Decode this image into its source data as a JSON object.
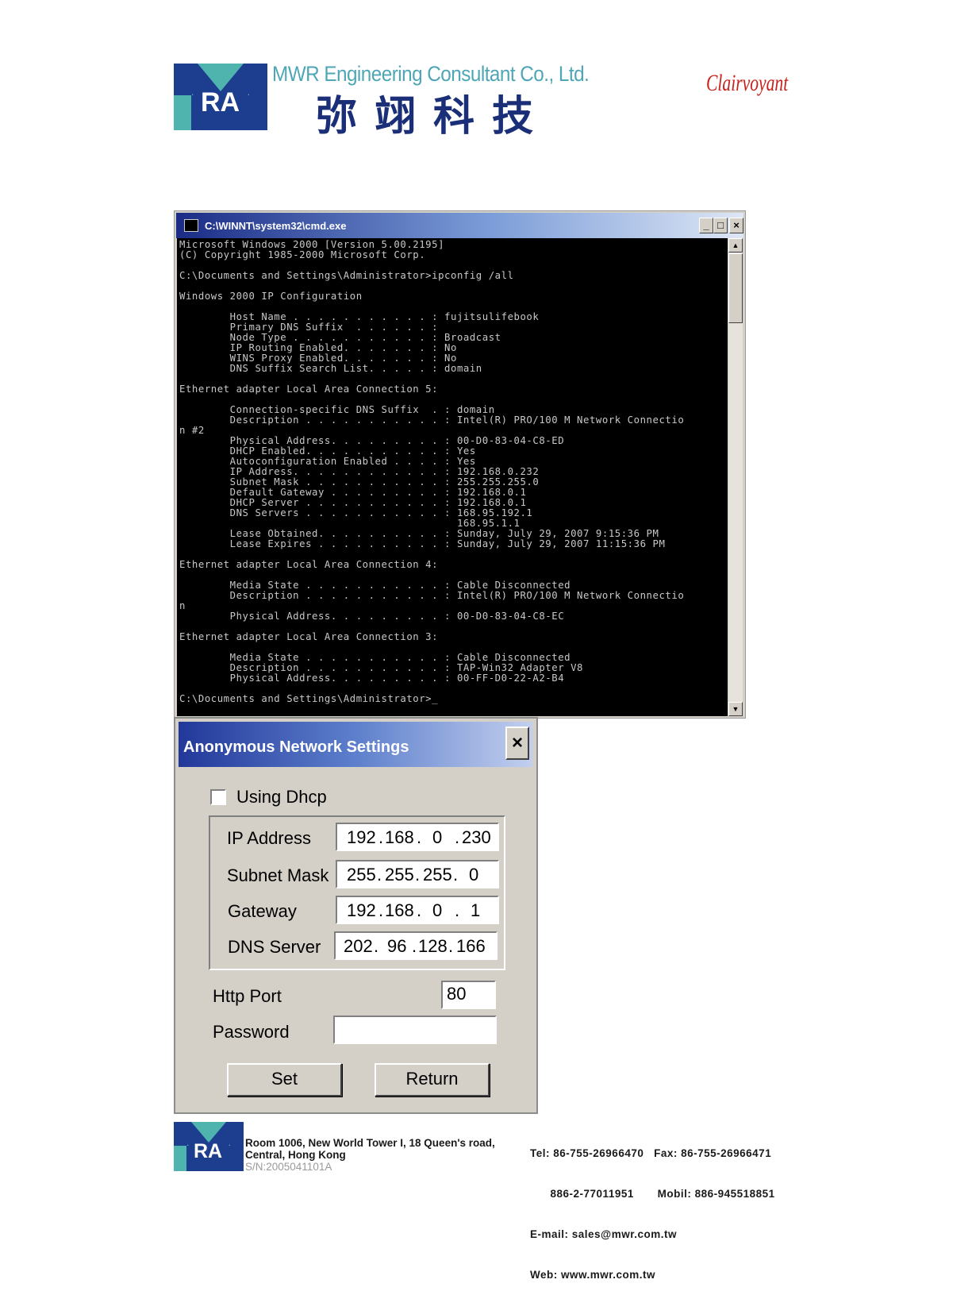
{
  "header": {
    "company_name": "MWR Engineering Consultant Co., Ltd.",
    "company_name_cn": "弥翊科技",
    "brand": "Clairvoyant"
  },
  "cmd": {
    "title": "C:\\WINNT\\system32\\cmd.exe",
    "minimize": "_",
    "maximize": "□",
    "close": "×",
    "lines": [
      "Microsoft Windows 2000 [Version 5.00.2195]",
      "(C) Copyright 1985-2000 Microsoft Corp.",
      "",
      "C:\\Documents and Settings\\Administrator>ipconfig /all",
      "",
      "Windows 2000 IP Configuration",
      "",
      "        Host Name . . . . . . . . . . . : fujitsulifebook",
      "        Primary DNS Suffix  . . . . . . :",
      "        Node Type . . . . . . . . . . . : Broadcast",
      "        IP Routing Enabled. . . . . . . : No",
      "        WINS Proxy Enabled. . . . . . . : No",
      "        DNS Suffix Search List. . . . . : domain",
      "",
      "Ethernet adapter Local Area Connection 5:",
      "",
      "        Connection-specific DNS Suffix  . : domain",
      "        Description . . . . . . . . . . . : Intel(R) PRO/100 M Network Connectio",
      "n #2",
      "        Physical Address. . . . . . . . . : 00-D0-83-04-C8-ED",
      "        DHCP Enabled. . . . . . . . . . . : Yes",
      "        Autoconfiguration Enabled . . . . : Yes",
      "        IP Address. . . . . . . . . . . . : 192.168.0.232",
      "        Subnet Mask . . . . . . . . . . . : 255.255.255.0",
      "        Default Gateway . . . . . . . . . : 192.168.0.1",
      "        DHCP Server . . . . . . . . . . . : 192.168.0.1",
      "        DNS Servers . . . . . . . . . . . : 168.95.192.1",
      "                                            168.95.1.1",
      "        Lease Obtained. . . . . . . . . . : Sunday, July 29, 2007 9:15:36 PM",
      "        Lease Expires . . . . . . . . . . : Sunday, July 29, 2007 11:15:36 PM",
      "",
      "Ethernet adapter Local Area Connection 4:",
      "",
      "        Media State . . . . . . . . . . . : Cable Disconnected",
      "        Description . . . . . . . . . . . : Intel(R) PRO/100 M Network Connectio",
      "n",
      "        Physical Address. . . . . . . . . : 00-D0-83-04-C8-EC",
      "",
      "Ethernet adapter Local Area Connection 3:",
      "",
      "        Media State . . . . . . . . . . . : Cable Disconnected",
      "        Description . . . . . . . . . . . : TAP-Win32 Adapter V8",
      "        Physical Address. . . . . . . . . : 00-FF-D0-22-A2-B4",
      "",
      "C:\\Documents and Settings\\Administrator>_"
    ]
  },
  "dialog": {
    "title": "Anonymous Network Settings",
    "close": "×",
    "using_dhcp_label": "Using Dhcp",
    "using_dhcp_checked": false,
    "ip_label": "IP Address",
    "ip": [
      "192",
      "168",
      "0",
      "230"
    ],
    "mask_label": "Subnet Mask",
    "mask": [
      "255",
      "255",
      "255",
      "0"
    ],
    "gateway_label": "Gateway",
    "gateway": [
      "192",
      "168",
      "0",
      "1"
    ],
    "dns_label": "DNS Server",
    "dns": [
      "202",
      "96",
      "128",
      "166"
    ],
    "http_port_label": "Http Port",
    "http_port": "80",
    "password_label": "Password",
    "password": "",
    "dot": ".",
    "set_label": "Set",
    "return_label": "Return"
  },
  "footer": {
    "address_line1": "Room 1006, New World Tower I, 18 Queen's road,",
    "address_line2": "Central, Hong Kong",
    "serial": "S/N:2005041101A",
    "tel": "Tel: 86-755-26966470   Fax: 86-755-26966471",
    "tel2": "      886-2-77011951       Mobil: 886-945518851",
    "email": "E-mail: sales@mwr.com.tw",
    "web": "Web: www.mwr.com.tw"
  },
  "colors": {
    "logo_teal": "#4fb3ae",
    "logo_navy": "#1d3d8f",
    "brand_red": "#c8211b"
  }
}
